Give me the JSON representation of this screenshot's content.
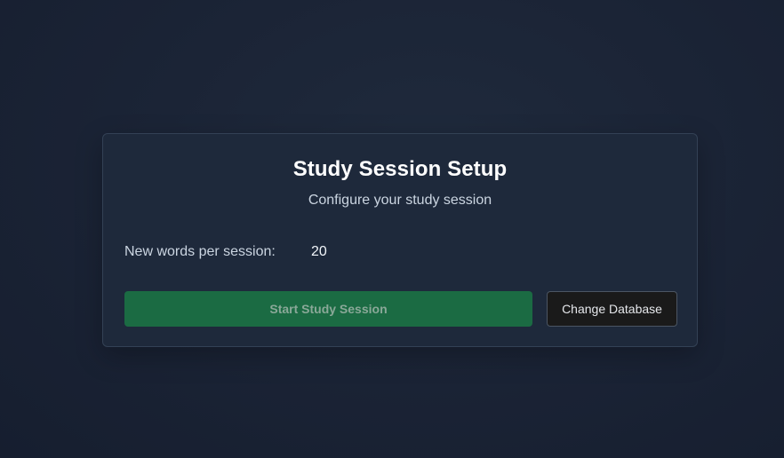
{
  "setup": {
    "title": "Study Session Setup",
    "subtitle": "Configure your study session",
    "new_words_label": "New words per session:",
    "new_words_value": "20"
  },
  "actions": {
    "start_label": "Start Study Session",
    "change_db_label": "Change Database"
  },
  "colors": {
    "background": "#1b2436",
    "card": "#1e293b",
    "accent_green": "#1b6b43",
    "button_dark": "#1a1a1a"
  }
}
